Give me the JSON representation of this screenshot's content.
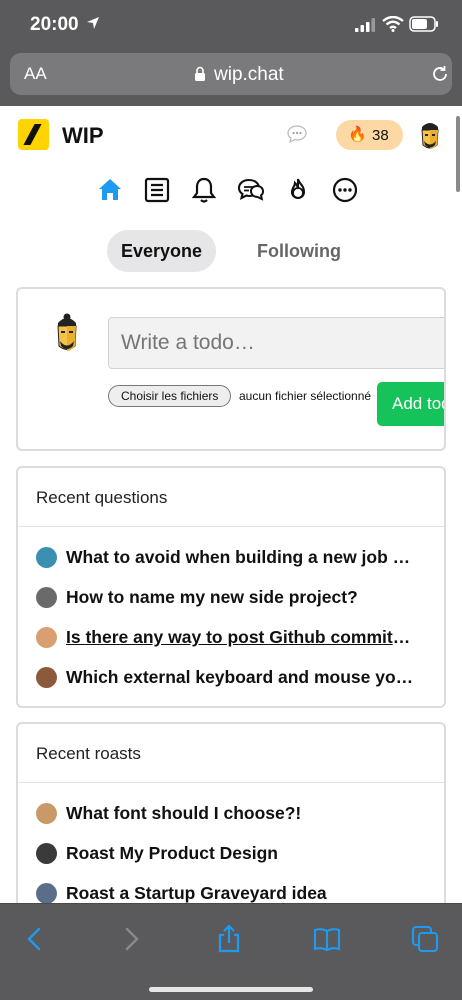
{
  "status_bar": {
    "time": "20:00"
  },
  "address_bar": {
    "text_size_label": "AA",
    "url": "wip.chat"
  },
  "header": {
    "brand": "WIP",
    "streak_count": "38",
    "streak_emoji": "🔥"
  },
  "nav": {
    "icons": [
      "home-icon",
      "todos-icon",
      "notifications-icon",
      "chat-icon",
      "streak-icon",
      "more-icon"
    ]
  },
  "feed_toggle": {
    "everyone": "Everyone",
    "following": "Following",
    "active": "Everyone"
  },
  "composer": {
    "placeholder": "Write a todo…",
    "file_button": "Choisir les fichiers",
    "file_status": "aucun fichier sélectionné",
    "submit": "Add todo"
  },
  "recent_questions": {
    "title": "Recent questions",
    "items": [
      {
        "text": "What to avoid when building a new job board",
        "avatar_color": "#3b8fb0"
      },
      {
        "text": "How to name my new side project?",
        "avatar_color": "#6a6a6a"
      },
      {
        "text": "Is there any way to post Github commits to WIP",
        "avatar_color": "#d8a070"
      },
      {
        "text": "Which external keyboard and mouse you use",
        "avatar_color": "#8a5a3a"
      }
    ]
  },
  "recent_roasts": {
    "title": "Recent roasts",
    "items": [
      {
        "text": "What font should I choose?!",
        "avatar_color": "#c89a6a"
      },
      {
        "text": "Roast My Product Design",
        "avatar_color": "#3a3a3a"
      },
      {
        "text": "Roast a Startup Graveyard idea",
        "avatar_color": "#5a6e8a"
      }
    ]
  },
  "colors": {
    "accent_blue": "#1d9bf0",
    "add_todo_green": "#16c35a",
    "brand_yellow": "#ffd400",
    "streak_bg": "#fcd9a4"
  }
}
